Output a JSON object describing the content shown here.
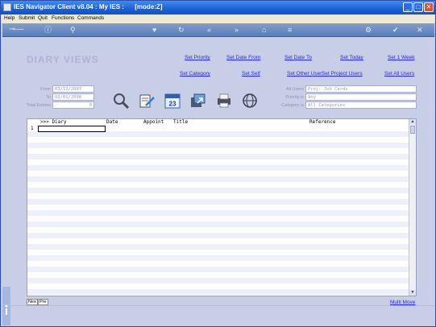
{
  "window": {
    "title": "IES Navigator Client v8.04 : My IES :      [mode:Z]",
    "buttons": [
      "_",
      "□",
      "✕"
    ]
  },
  "menu": [
    "Help",
    "Submit",
    "Quit",
    "Functions",
    "Commands"
  ],
  "toolbar_icons": [
    "key-icon",
    "info-icon",
    "search-icon",
    "heart-icon",
    "refresh-icon",
    "rewind-icon",
    "fast-forward-icon",
    "home-icon",
    "list-icon",
    "settings-icon",
    "check-icon",
    "close-icon"
  ],
  "page": {
    "heading": "DIARY VIEWS",
    "links_row1": [
      "Set Priority",
      "Set Date From",
      "Set Date To",
      "Set Today",
      "Set 1 Week"
    ],
    "links_row2": [
      "Set Category",
      "Set Self",
      "Set Other User",
      "Set Project Users",
      "Set All Users"
    ],
    "filters_left": [
      {
        "label": "From",
        "value": "03/12/2007"
      },
      {
        "label": "To",
        "value": "03/01/2008"
      },
      {
        "label": "Total Entries",
        "value": "0"
      }
    ],
    "filters_right": [
      {
        "label": "All Users",
        "value": "Proj: Job Cards"
      },
      {
        "label": "Priority is",
        "value": "Any"
      },
      {
        "label": "Category is",
        "value": "All Categories"
      }
    ],
    "calendar_day": "23"
  },
  "grid": {
    "columns": [
      ">>> Diary",
      "Date",
      "Appoint",
      "Title",
      "Reference"
    ],
    "row_number": "1",
    "row_count": 1
  },
  "pager": {
    "next": "Nex",
    "prev": "Pre"
  },
  "footer": {
    "multi_move": "Multi Move"
  },
  "colors": {
    "title_bar": "#1b5fd6",
    "background": "#c8cee6",
    "link": "#2a2ad8"
  }
}
